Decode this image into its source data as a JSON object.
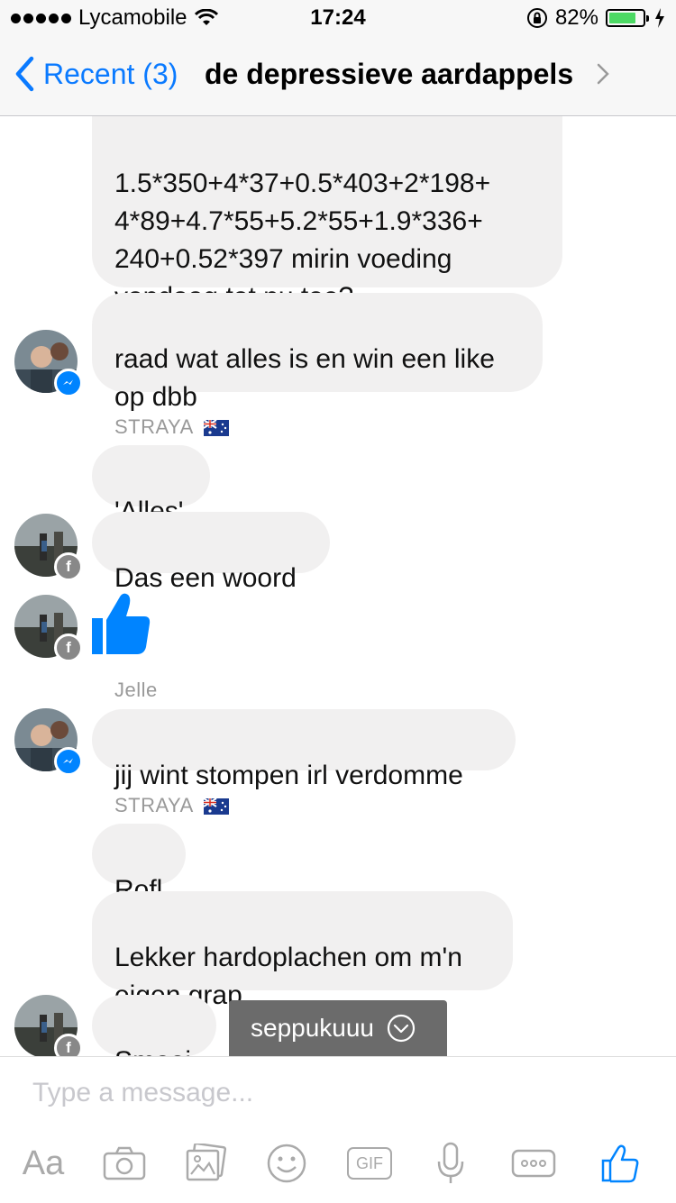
{
  "status_bar": {
    "carrier": "Lycamobile",
    "time": "17:24",
    "battery_percent": "82%",
    "battery_level": 0.82
  },
  "nav": {
    "back_label": "Recent (3)",
    "title": "de depressieve aardappels"
  },
  "messages": {
    "m1": "1.5*350+4*37+0.5*403+2*198+\n4*89+4.7*55+5.2*55+1.9*336+\n240+0.52*397 mirin voeding\nvandaag tot nu toe?",
    "m2": "raad wat alles is en win een like\nop dbb",
    "sender_straya_1": "STRAYA",
    "m3": "'Alles'",
    "m4": "Das een woord",
    "sender_jelle": "Jelle",
    "m5": "jij wint stompen irl verdomme",
    "sender_straya_2": "STRAYA",
    "m6": "Rofl",
    "m7": "Lekker hardoplachen om m'n\neigen grap",
    "m8": "Smooi"
  },
  "tooltip": {
    "label": "seppukuuu"
  },
  "composer": {
    "placeholder": "Type a message...",
    "text_tool_label": "Aa",
    "gif_label": "GIF"
  },
  "icons": {
    "wifi": "wifi-icon",
    "lock": "orientation-lock-icon",
    "charging": "charging-bolt-icon",
    "like": "thumbs-up-icon",
    "camera": "camera-icon",
    "photos": "photo-gallery-icon",
    "emoji": "emoji-icon",
    "mic": "microphone-icon",
    "more": "more-icon"
  },
  "colors": {
    "accent": "#0a7aff",
    "bubble": "#f1f0f0",
    "messenger_badge": "#0084ff",
    "battery": "#4cd964",
    "tooltip": "#6b6b6b"
  }
}
